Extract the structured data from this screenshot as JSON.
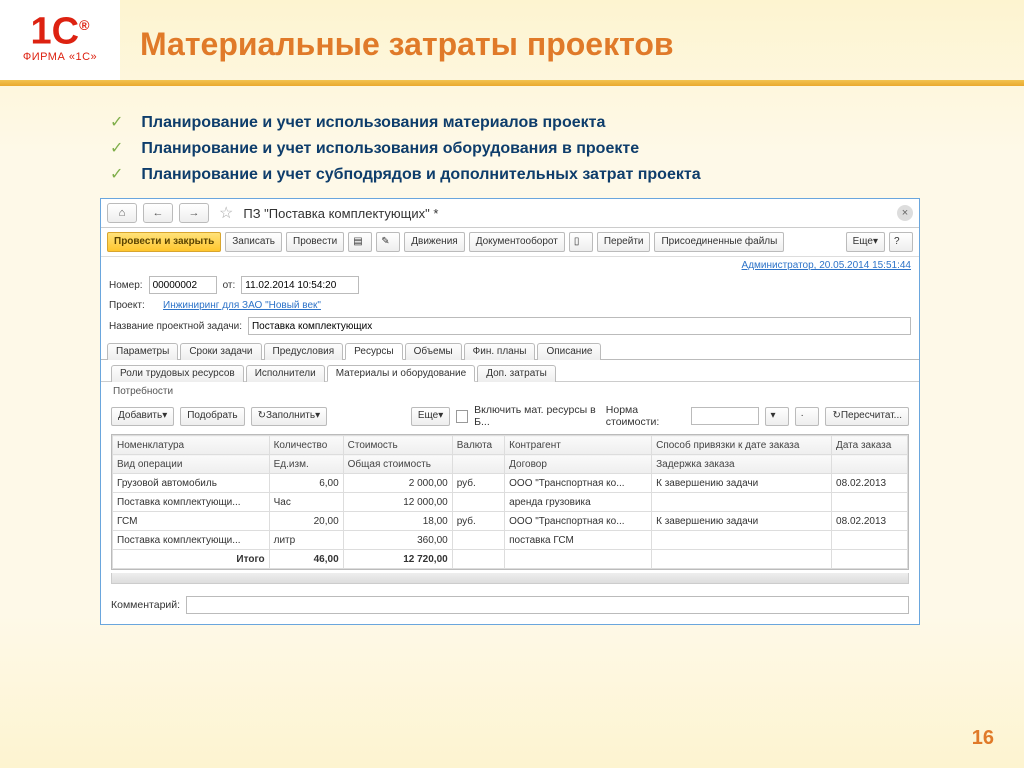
{
  "logo_company": "ФИРМА «1С»",
  "slide_title": "Материальные затраты проектов",
  "bullets": [
    "Планирование и учет использования материалов проекта",
    "Планирование и учет использования оборудования в проекте",
    "Планирование и учет субподрядов и дополнительных затрат проекта"
  ],
  "window": {
    "title": "ПЗ \"Поставка комплектующих\" *"
  },
  "toolbar": {
    "post_close": "Провести и закрыть",
    "write": "Записать",
    "post": "Провести",
    "movements": "Движения",
    "docflow": "Документооборот",
    "goto": "Перейти",
    "files": "Присоединенные файлы",
    "more": "Еще",
    "help": "?"
  },
  "user_stamp": "Администратор, 20.05.2014 15:51:44",
  "form": {
    "number_lbl": "Номер:",
    "number_val": "00000002",
    "date_lbl": "от:",
    "date_val": "11.02.2014 10:54:20",
    "project_lbl": "Проект:",
    "project_link": "Инжиниринг для ЗАО \"Новый век\"",
    "task_lbl": "Название проектной задачи:",
    "task_val": "Поставка комплектующих"
  },
  "tabs": [
    "Параметры",
    "Сроки задачи",
    "Предусловия",
    "Ресурсы",
    "Объемы",
    "Фин. планы",
    "Описание"
  ],
  "active_tab": 3,
  "subtabs": [
    "Роли трудовых ресурсов",
    "Исполнители",
    "Материалы и оборудование",
    "Доп. затраты"
  ],
  "active_subtab": 2,
  "section_label": "Потребности",
  "mini": {
    "add": "Добавить",
    "pick": "Подобрать",
    "fill": "Заполнить",
    "more": "Еще",
    "include": "Включить мат. ресурсы в Б...",
    "rate_lbl": "Норма стоимости:",
    "recalc": "Пересчитат..."
  },
  "grid": {
    "h1": [
      "Номенклатура",
      "Количество",
      "Стоимость",
      "Валюта",
      "Контрагент",
      "Способ привязки к дате заказа",
      "Дата заказа"
    ],
    "h2": [
      "Вид операции",
      "Ед.изм.",
      "Общая стоимость",
      "",
      "Договор",
      "Задержка заказа",
      ""
    ],
    "rows": [
      {
        "c1": "Грузовой автомобиль",
        "c2": "6,00",
        "c3": "2 000,00",
        "c4": "руб.",
        "c5": "ООО \"Транспортная ко...",
        "c6": "К завершению задачи",
        "c7": "08.02.2013"
      },
      {
        "c1": "Поставка комплектующи...",
        "c2": "Час",
        "c3": "12 000,00",
        "c4": "",
        "c5": "аренда грузовика",
        "c6": "",
        "c7": ""
      },
      {
        "c1": "ГСМ",
        "c2": "20,00",
        "c3": "18,00",
        "c4": "руб.",
        "c5": "ООО \"Транспортная ко...",
        "c6": "К завершению задачи",
        "c7": "08.02.2013"
      },
      {
        "c1": "Поставка комплектующи...",
        "c2": "литр",
        "c3": "360,00",
        "c4": "",
        "c5": "поставка ГСМ",
        "c6": "",
        "c7": ""
      }
    ],
    "total_lbl": "Итого",
    "total_qty": "46,00",
    "total_cost": "12 720,00"
  },
  "comment_lbl": "Комментарий:",
  "page_num": "16"
}
